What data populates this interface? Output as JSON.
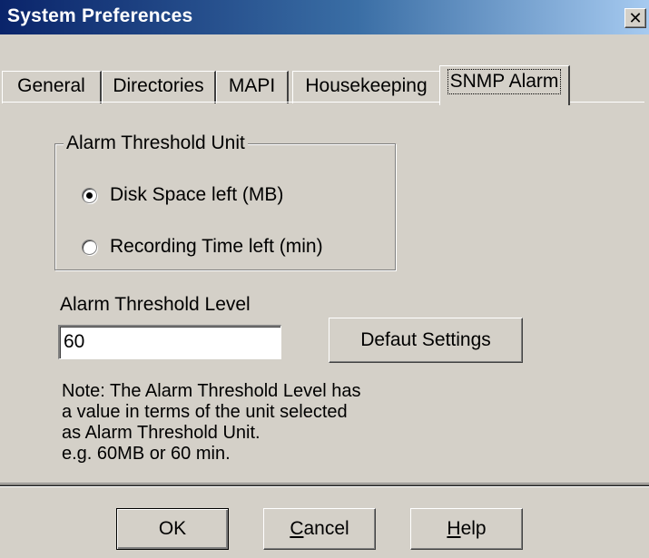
{
  "window": {
    "title": "System Preferences",
    "close_glyph": "✕"
  },
  "tabs": [
    {
      "label": "General",
      "active": false
    },
    {
      "label": "Directories",
      "active": false
    },
    {
      "label": "MAPI",
      "active": false
    },
    {
      "label": "Housekeeping",
      "active": false
    },
    {
      "label": "SNMP Alarm",
      "active": true
    }
  ],
  "threshold_unit": {
    "legend": "Alarm Threshold Unit",
    "options": [
      {
        "label": "Disk Space left (MB)",
        "checked": true
      },
      {
        "label": "Recording Time left (min)",
        "checked": false
      }
    ]
  },
  "threshold_level": {
    "label": "Alarm Threshold Level",
    "value": "60"
  },
  "default_settings_button": "Defaut Settings",
  "note": [
    "Note: The Alarm Threshold Level has",
    "a value in terms of the unit selected",
    "as Alarm Threshold Unit.",
    "e.g. 60MB or 60 min."
  ],
  "footer": {
    "ok": "OK",
    "cancel_first": "C",
    "cancel_rest": "ancel",
    "help_first": "H",
    "help_rest": "elp"
  },
  "colors": {
    "dialog_bg": "#d4d0c8",
    "title_start": "#0a246a",
    "title_end": "#a6caf0"
  }
}
